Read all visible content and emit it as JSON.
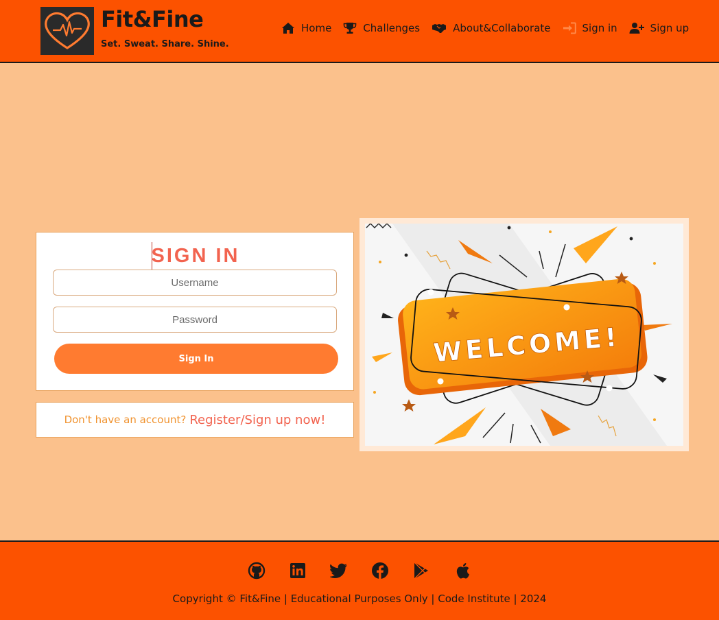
{
  "header": {
    "brand_name": "Fit&Fine",
    "brand_tagline": "Set. Sweat. Share. Shine.",
    "nav": [
      {
        "label": "Home",
        "icon": "home-icon"
      },
      {
        "label": "Challenges",
        "icon": "trophy-icon"
      },
      {
        "label": "About&Collaborate",
        "icon": "handshake-icon"
      },
      {
        "label": "Sign in",
        "icon": "sign-in-icon"
      },
      {
        "label": "Sign up",
        "icon": "user-plus-icon"
      }
    ]
  },
  "signin": {
    "title": "SIGN IN",
    "username_placeholder": "Username",
    "password_placeholder": "Password",
    "button_label": "Sign In"
  },
  "register": {
    "question": "Don't have an account?",
    "link": "Register/Sign up now!"
  },
  "welcome_image": {
    "text": "WELCOME!"
  },
  "footer": {
    "social": [
      "github-icon",
      "linkedin-icon",
      "twitter-icon",
      "facebook-icon",
      "google-play-icon",
      "apple-icon"
    ],
    "copyright": "Copyright © Fit&Fine | Educational Purposes Only | Code Institute | 2024"
  },
  "colors": {
    "header_bg": "#fc5200",
    "page_bg": "#fbc18c",
    "title_red": "#f2634f",
    "button_orange": "#ff7b30"
  }
}
